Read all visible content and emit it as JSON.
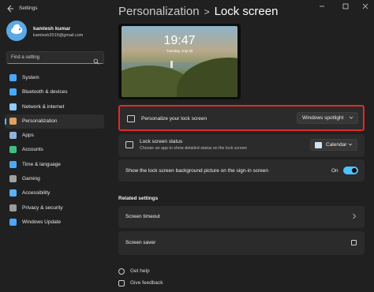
{
  "window": {
    "app_title": "Settings",
    "back_icon": "back-arrow-icon",
    "controls": [
      "minimize-icon",
      "maximize-icon",
      "close-icon"
    ]
  },
  "profile": {
    "name": "kamlesh kumar",
    "email": "kamlesh2019@gmail.com"
  },
  "search": {
    "placeholder": "Find a setting"
  },
  "sidebar": {
    "items": [
      {
        "label": "System",
        "icon": "system-icon",
        "color": "#4aa8ff"
      },
      {
        "label": "Bluetooth & devices",
        "icon": "bluetooth-icon",
        "color": "#4aa8ff"
      },
      {
        "label": "Network & internet",
        "icon": "network-icon",
        "color": "#8ec9ff"
      },
      {
        "label": "Personalization",
        "icon": "personalization-icon",
        "color": "#e0a060"
      },
      {
        "label": "Apps",
        "icon": "apps-icon",
        "color": "#8fb4d8"
      },
      {
        "label": "Accounts",
        "icon": "accounts-icon",
        "color": "#3fbf7f"
      },
      {
        "label": "Time & language",
        "icon": "time-language-icon",
        "color": "#4aa8ff"
      },
      {
        "label": "Gaming",
        "icon": "gaming-icon",
        "color": "#a0a0a0"
      },
      {
        "label": "Accessibility",
        "icon": "accessibility-icon",
        "color": "#5ab0ff"
      },
      {
        "label": "Privacy & security",
        "icon": "privacy-icon",
        "color": "#9a9a9a"
      },
      {
        "label": "Windows Update",
        "icon": "windows-update-icon",
        "color": "#4aa8ff"
      }
    ],
    "active_index": 3
  },
  "breadcrumb": {
    "parent": "Personalization",
    "separator": ">",
    "current": "Lock screen"
  },
  "preview": {
    "time": "19:47",
    "date": "Tuesday, July 29"
  },
  "settings": {
    "personalize": {
      "label": "Personalize your lock screen",
      "value": "Windows spotlight"
    },
    "status": {
      "label": "Lock screen status",
      "sublabel": "Choose an app to show detailed status on the lock screen",
      "value": "Calendar"
    },
    "background": {
      "label": "Show the lock screen background picture on the sign-in screen",
      "state": "On"
    }
  },
  "related": {
    "heading": "Related settings",
    "items": [
      {
        "label": "Screen timeout"
      },
      {
        "label": "Screen saver"
      }
    ]
  },
  "help": {
    "get_help": "Get help",
    "feedback": "Give feedback"
  },
  "colors": {
    "accent": "#4cc2ff",
    "highlight_border": "#e02a2a",
    "background": "#202020",
    "card": "#2b2b2b"
  }
}
